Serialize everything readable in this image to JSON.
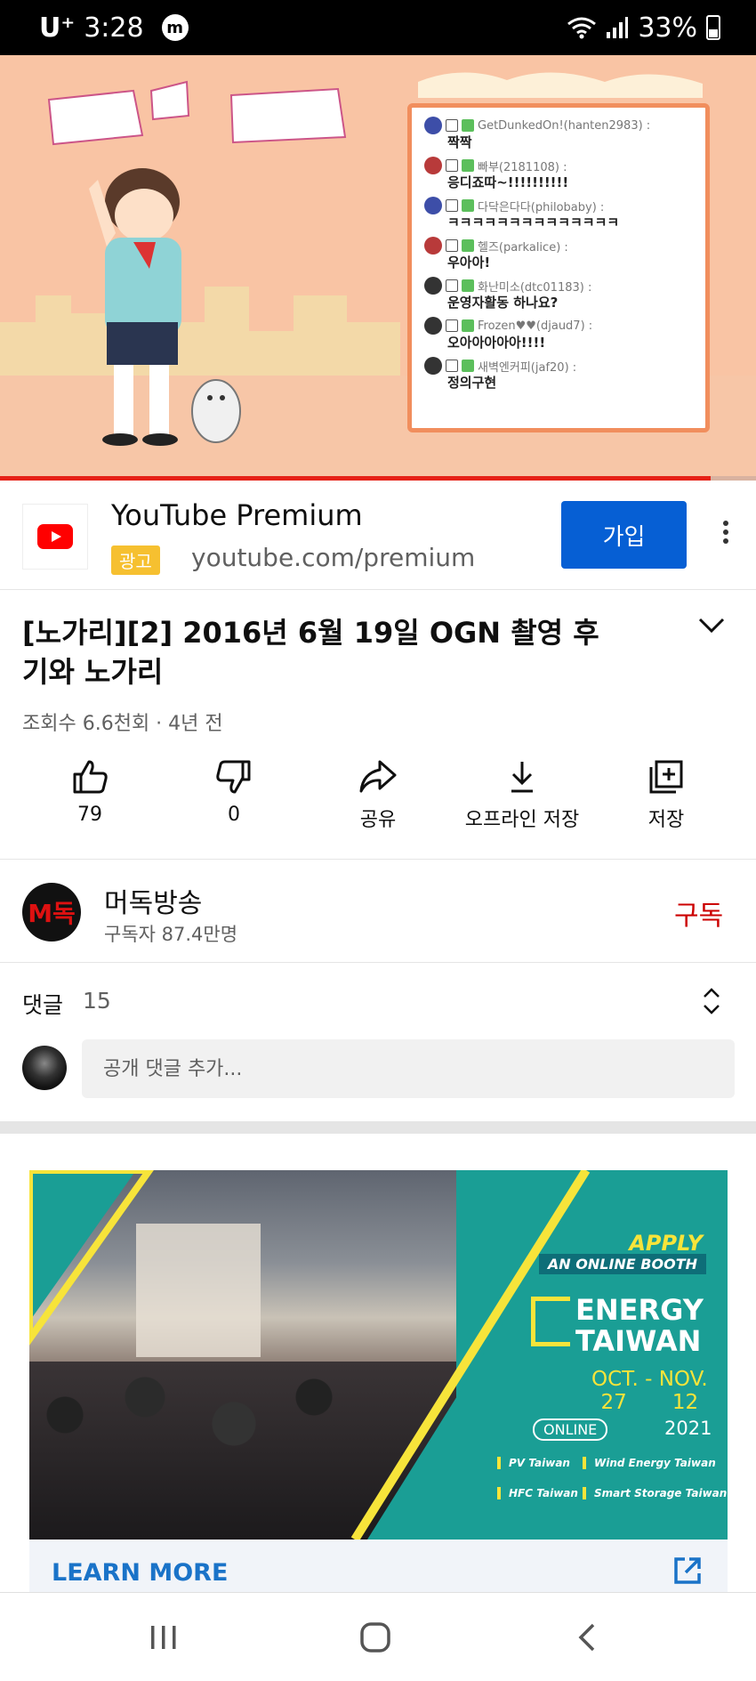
{
  "status_bar": {
    "carrier": "U⁺",
    "time": "3:28",
    "app_badge": "m",
    "battery": "33%"
  },
  "video": {
    "progress_fraction": 0.94,
    "chat": [
      {
        "user": "GetDunkedOn!(hanten2983) :",
        "text": "짝짝",
        "avatar_color": "#3d4ea8"
      },
      {
        "user": "빠부(2181108) :",
        "text": "응디죠따~!!!!!!!!!!",
        "avatar_color": "#b83a3a"
      },
      {
        "user": "다닥은다다(philobaby) :",
        "text": "ㅋㅋㅋㅋㅋㅋㅋㅋㅋㅋㅋㅋㅋㅋ",
        "avatar_color": "#3d4ea8"
      },
      {
        "user": "헬즈(parkalice) :",
        "text": "우아아!",
        "avatar_color": "#b83a3a"
      },
      {
        "user": "화난미소(dtc01183) :",
        "text": "운영자활동 하나요?",
        "avatar_color": "#333333"
      },
      {
        "user": "Frozen♥♥(djaud7) :",
        "text": "오아아아아아!!!!",
        "avatar_color": "#333333"
      },
      {
        "user": "새벽엔커피(jaf20) :",
        "text": "정의구현",
        "avatar_color": "#333333"
      }
    ]
  },
  "ad": {
    "title": "YouTube Premium",
    "badge": "광고",
    "url": "youtube.com/premium",
    "button": "가입",
    "more_icon": "more-vert-icon"
  },
  "video_info": {
    "title": "[노가리][2] 2016년 6월 19일 OGN 촬영 후기와 노가리",
    "meta": "조회수 6.6천회 · 4년 전",
    "actions": [
      {
        "id": "like",
        "icon": "thumbs-up-icon",
        "label": "79"
      },
      {
        "id": "dislike",
        "icon": "thumbs-down-icon",
        "label": "0"
      },
      {
        "id": "share",
        "icon": "share-icon",
        "label": "공유"
      },
      {
        "id": "offline",
        "icon": "download-icon",
        "label": "오프라인 저장"
      },
      {
        "id": "save",
        "icon": "playlist-add-icon",
        "label": "저장"
      }
    ]
  },
  "channel": {
    "avatar_text": "M독",
    "name": "머독방송",
    "subscribers": "구독자 87.4만명",
    "subscribe": "구독"
  },
  "comments": {
    "title": "댓글",
    "count": "15",
    "placeholder": "공개 댓글 추가..."
  },
  "banner_ad": {
    "apply": "APPLY",
    "booth": "AN ONLINE BOOTH",
    "brand_line1": "ENERGY",
    "brand_line2": "TAIWAN",
    "dates_line1": "OCT. - NOV.",
    "dates_line2": "27       12",
    "online": "ONLINE",
    "year": "2021",
    "tags": [
      "PV Taiwan",
      "Wind Energy Taiwan",
      "HFC Taiwan",
      "Smart Storage Taiwan"
    ],
    "cta": "LEARN MORE"
  },
  "nav": {
    "recent_icon": "recent-apps-icon",
    "home_icon": "home-icon",
    "back_icon": "back-icon"
  },
  "colors": {
    "accent_blue": "#065fd4",
    "subscribe_red": "#cc0000",
    "progress_red": "#e62117",
    "ad_badge": "#f6c030"
  }
}
